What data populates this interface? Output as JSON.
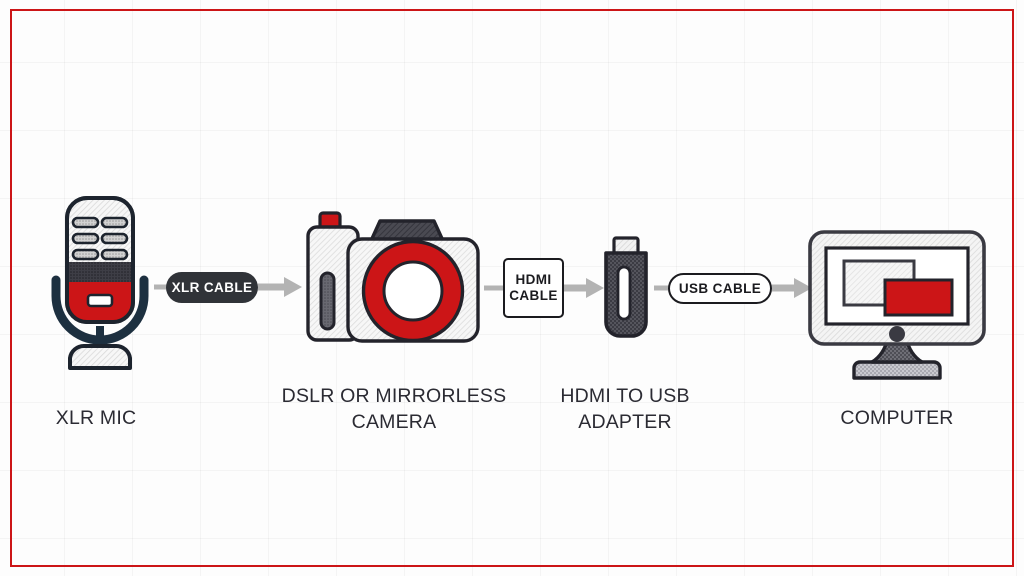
{
  "diagram": {
    "title": "XLR mic to computer audio/video signal chain",
    "border_color": "#cc1517",
    "accent_red": "#cc1517",
    "dark": "#2b2b33",
    "navy": "#1d3040",
    "arrow_gray": "#b3b3b3",
    "background": "#fdfdfd"
  },
  "nodes": [
    {
      "id": "xlr-mic",
      "icon": "microphone-icon",
      "caption": "XLR MIC"
    },
    {
      "id": "camera",
      "icon": "dslr-camera-icon",
      "caption": "DSLR OR MIRRORLESS\nCAMERA"
    },
    {
      "id": "adapter",
      "icon": "hdmi-usb-dongle-icon",
      "caption": "HDMI TO USB\nADAPTER"
    },
    {
      "id": "computer",
      "icon": "desktop-monitor-icon",
      "caption": "COMPUTER"
    }
  ],
  "connectors": [
    {
      "id": "xlr-cable",
      "label": "XLR CABLE",
      "style": "dark-pill",
      "from": "xlr-mic",
      "to": "camera"
    },
    {
      "id": "hdmi-cable",
      "label": "HDMI\nCABLE",
      "line1": "HDMI",
      "line2": "CABLE",
      "style": "outline-box",
      "from": "camera",
      "to": "adapter"
    },
    {
      "id": "usb-cable",
      "label": "USB CABLE",
      "style": "outline-pill",
      "from": "adapter",
      "to": "computer"
    }
  ]
}
